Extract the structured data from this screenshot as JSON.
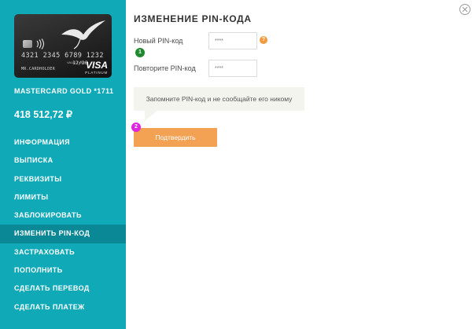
{
  "card": {
    "number": "4321 2345 6789 1232",
    "valid_thru_label": "VALID THRU",
    "expiry": "12/26",
    "holder": "MR.CARDHOLDER",
    "brand": "VISA",
    "tier": "PLATINUM",
    "icons": [
      "bird-logo-icon",
      "chip-icon",
      "contactless-icon"
    ]
  },
  "account": {
    "card_name": "MASTERCARD GOLD *1711",
    "balance": "418 512,72 ₽"
  },
  "menu": {
    "items": [
      {
        "label": "ИНФОРМАЦИЯ"
      },
      {
        "label": "ВЫПИСКА"
      },
      {
        "label": "РЕКВИЗИТЫ"
      },
      {
        "label": "ЛИМИТЫ"
      },
      {
        "label": "ЗАБЛОКИРОВАТЬ"
      },
      {
        "label": "ИЗМЕНИТЬ PIN-КОД",
        "active": true
      },
      {
        "label": "ЗАСТРАХОВАТЬ"
      },
      {
        "label": "ПОПОЛНИТЬ"
      },
      {
        "label": "СДЕЛАТЬ ПЕРЕВОД"
      },
      {
        "label": "СДЕЛАТЬ ПЛАТЕЖ"
      }
    ]
  },
  "form": {
    "title": "ИЗМЕНЕНИЕ PIN-КОДА",
    "new_pin_label": "Новый PIN-код",
    "new_pin_placeholder": "****",
    "repeat_pin_label": "Повторите PIN-код",
    "repeat_pin_placeholder": "****",
    "help_symbol": "?",
    "step_one": "1",
    "step_two": "2",
    "notice": "Запомните PIN-код и не сообщайте его никому",
    "confirm_label": "Подтвердить"
  },
  "colors": {
    "sidebar": "#0fa9b8",
    "active_item": "#0b8896",
    "accent": "#f3a153",
    "help": "#f19a3e",
    "step_one": "#1e8a2d",
    "step_two": "#e025e0"
  },
  "window": {
    "close_icon": "close-icon"
  }
}
